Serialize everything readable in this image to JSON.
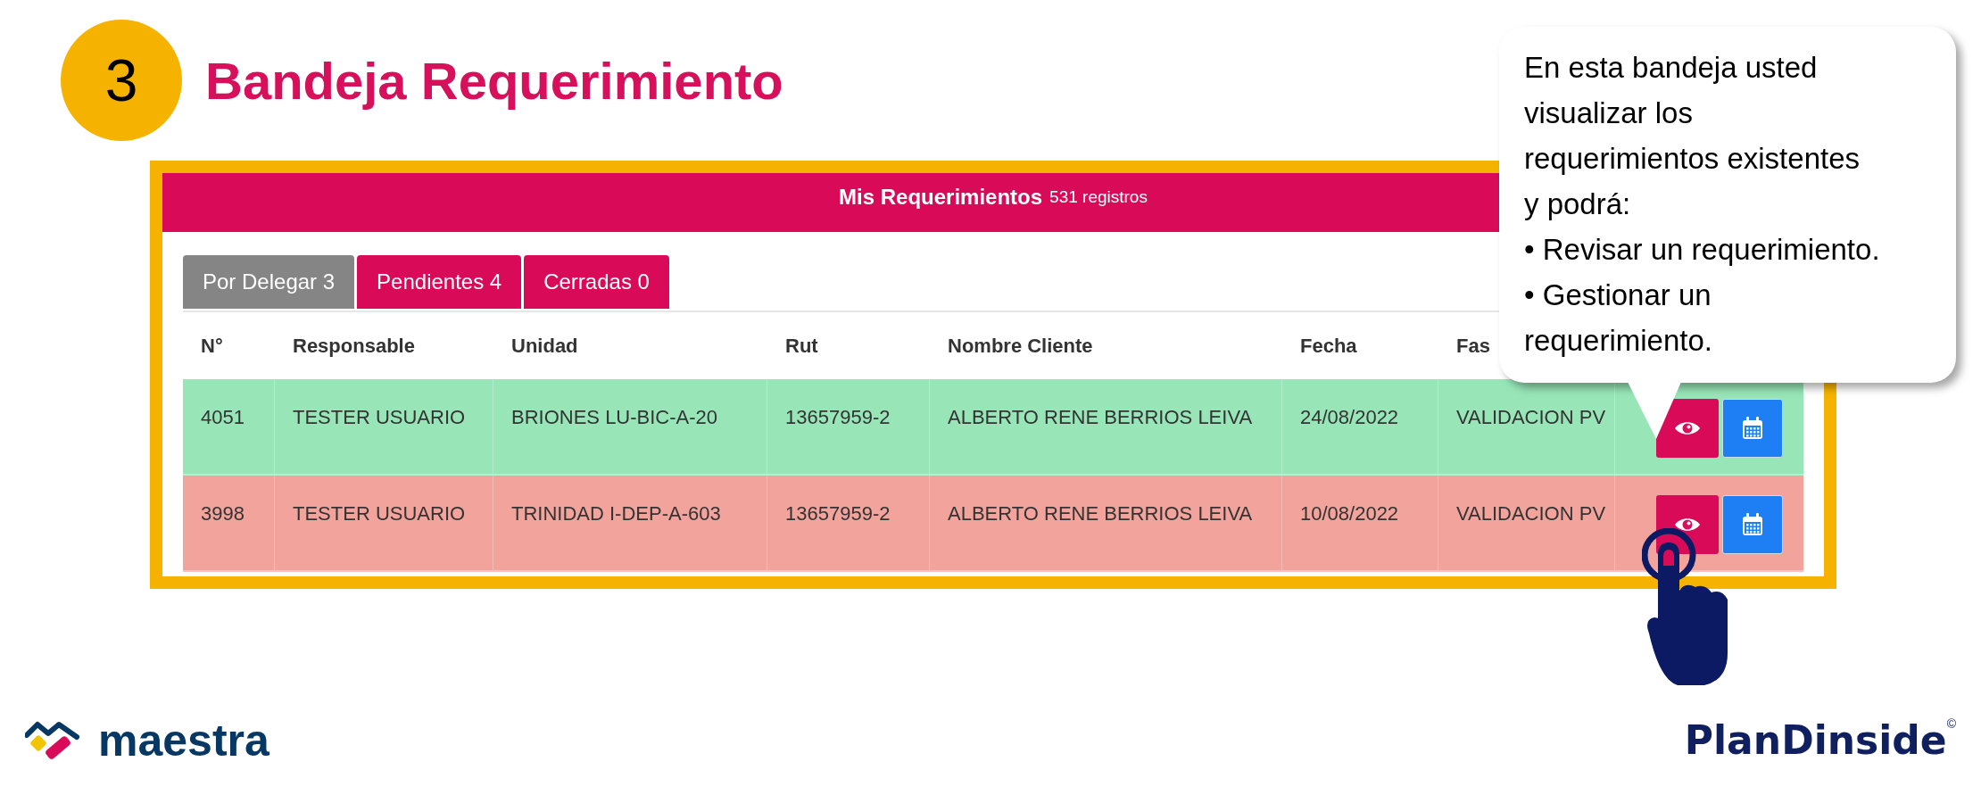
{
  "step": {
    "number": "3",
    "title": "Bandeja Requerimiento"
  },
  "panel": {
    "title": "Mis Requerimientos",
    "count": "531 registros",
    "tabs": [
      {
        "label": "Por Delegar 3",
        "selected": true
      },
      {
        "label": "Pendientes 4",
        "selected": false
      },
      {
        "label": "Cerradas 0",
        "selected": false
      }
    ],
    "columns": [
      "N°",
      "Responsable",
      "Unidad",
      "Rut",
      "Nombre Cliente",
      "Fecha",
      "Fas"
    ],
    "rows": [
      {
        "color": "#98e6b8",
        "cells": [
          "4051",
          "TESTER USUARIO",
          "BRIONES LU-BIC-A-20",
          "13657959-2",
          "ALBERTO RENE BERRIOS LEIVA",
          "24/08/2022",
          "VALIDACION PV"
        ]
      },
      {
        "color": "#f2a49c",
        "cells": [
          "3998",
          "TESTER USUARIO",
          "TRINIDAD I-DEP-A-603",
          "13657959-2",
          "ALBERTO RENE BERRIOS LEIVA",
          "10/08/2022",
          "VALIDACION PV"
        ]
      }
    ]
  },
  "callout": {
    "lines": [
      "En esta bandeja usted",
      "visualizar los",
      "requerimientos existentes",
      "y podrá:",
      "• Revisar un requerimiento.",
      "• Gestionar un",
      "requerimiento."
    ]
  },
  "footer": {
    "brand_left": "maestra",
    "brand_right": "PlanDinside",
    "copyright": "©"
  }
}
